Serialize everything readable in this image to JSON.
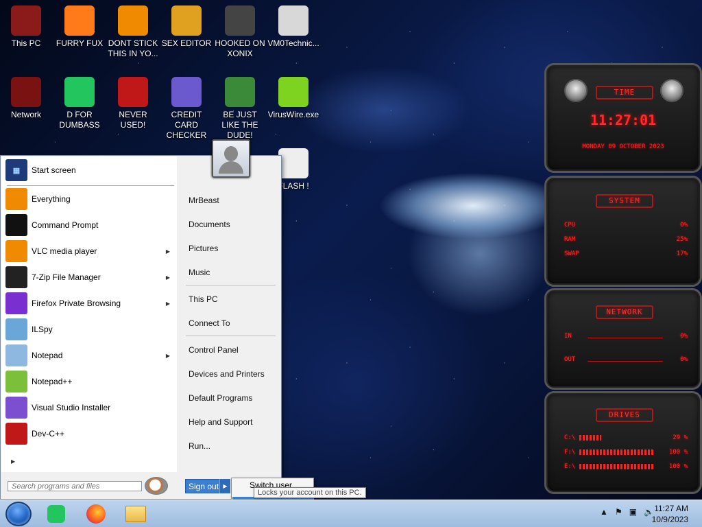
{
  "desktop_icons": [
    {
      "label": "This PC",
      "icon": "computer-icon",
      "color": "#8a1b1b"
    },
    {
      "label": "FURRY FUX",
      "icon": "firefox-icon",
      "color": "#ff7a18"
    },
    {
      "label": "DONT STICK THIS IN YO...",
      "icon": "vlc-icon",
      "color": "#f08a00"
    },
    {
      "label": "SEX EDITOR",
      "icon": "hxd-icon",
      "color": "#e0a020"
    },
    {
      "label": "HOOKED ON XONIX",
      "icon": "xonix-icon",
      "color": "#444"
    },
    {
      "label": "VM0Technic...",
      "icon": "doctor-icon",
      "color": "#d8d8d8"
    },
    {
      "label": "Network",
      "icon": "network-icon",
      "color": "#7a1212"
    },
    {
      "label": "D FOR DUMBASS",
      "icon": "d-app-icon",
      "color": "#22c55e"
    },
    {
      "label": "NEVER USED!",
      "icon": "devcpp-icon",
      "color": "#c01818"
    },
    {
      "label": "CREDIT CARD CHECKER",
      "icon": "credit-card-icon",
      "color": "#6a5acd"
    },
    {
      "label": "BE JUST LIKE THE DUDE!",
      "icon": "santa-icon",
      "color": "#3a8a3a"
    },
    {
      "label": "VirusWire.exe",
      "icon": "lime-icon",
      "color": "#7ed321"
    },
    {
      "label": "FLASH !",
      "icon": "flash-icon",
      "color": "#eee"
    }
  ],
  "start_menu": {
    "start_screen": "Start screen",
    "programs": [
      {
        "label": "Everything",
        "icon": "magnifier-icon",
        "color": "#f08a00",
        "submenu": false
      },
      {
        "label": "Command Prompt",
        "icon": "cmd-icon",
        "color": "#111",
        "submenu": false
      },
      {
        "label": "VLC media player",
        "icon": "vlc-icon",
        "color": "#f08a00",
        "submenu": true
      },
      {
        "label": "7-Zip File Manager",
        "icon": "7zip-icon",
        "color": "#222",
        "submenu": true
      },
      {
        "label": "Firefox Private Browsing",
        "icon": "firefox-private-icon",
        "color": "#7a2fd0",
        "submenu": true
      },
      {
        "label": "ILSpy",
        "icon": "ilspy-icon",
        "color": "#6aa7d8",
        "submenu": false
      },
      {
        "label": "Notepad",
        "icon": "notepad-icon",
        "color": "#8fb8e0",
        "submenu": true
      },
      {
        "label": "Notepad++",
        "icon": "notepadpp-icon",
        "color": "#7bbf3a",
        "submenu": false
      },
      {
        "label": "Visual Studio Installer",
        "icon": "vs-installer-icon",
        "color": "#7b4fcf",
        "submenu": false
      },
      {
        "label": "Dev-C++",
        "icon": "devcpp-icon",
        "color": "#c01818",
        "submenu": false
      }
    ],
    "search_placeholder": "Search programs and files",
    "right_links": [
      "MrBeast",
      "Documents",
      "Pictures",
      "Music",
      "This PC",
      "Connect To",
      "Control Panel",
      "Devices and Printers",
      "Default Programs",
      "Help and Support",
      "Run..."
    ],
    "sign_out": "Sign out",
    "submenu": {
      "switch_user": "Switch user",
      "lock": "Lock"
    },
    "tooltip": "Locks your account on this PC."
  },
  "taskbar": {
    "apps": [
      "d-app-icon",
      "firefox-icon",
      "file-explorer-icon"
    ],
    "time": "11:27 AM",
    "date": "10/9/2023"
  },
  "gadgets": {
    "time": {
      "title": "TIME",
      "clock": "11:27:01",
      "date": "MONDAY 09 OCTOBER 2023"
    },
    "system": {
      "title": "SYSTEM",
      "rows": [
        {
          "label": "CPU",
          "value": "0%"
        },
        {
          "label": "RAM",
          "value": "25%"
        },
        {
          "label": "SWAP",
          "value": "17%"
        }
      ]
    },
    "network": {
      "title": "NETWORK",
      "rows": [
        {
          "label": "IN",
          "value": "0%"
        },
        {
          "label": "OUT",
          "value": "0%"
        }
      ]
    },
    "drives": {
      "title": "DRIVES",
      "rows": [
        {
          "label": "C:\\",
          "value": "29 %",
          "level": 29
        },
        {
          "label": "F:\\",
          "value": "100 %",
          "level": 100
        },
        {
          "label": "E:\\",
          "value": "100 %",
          "level": 100
        }
      ]
    }
  }
}
